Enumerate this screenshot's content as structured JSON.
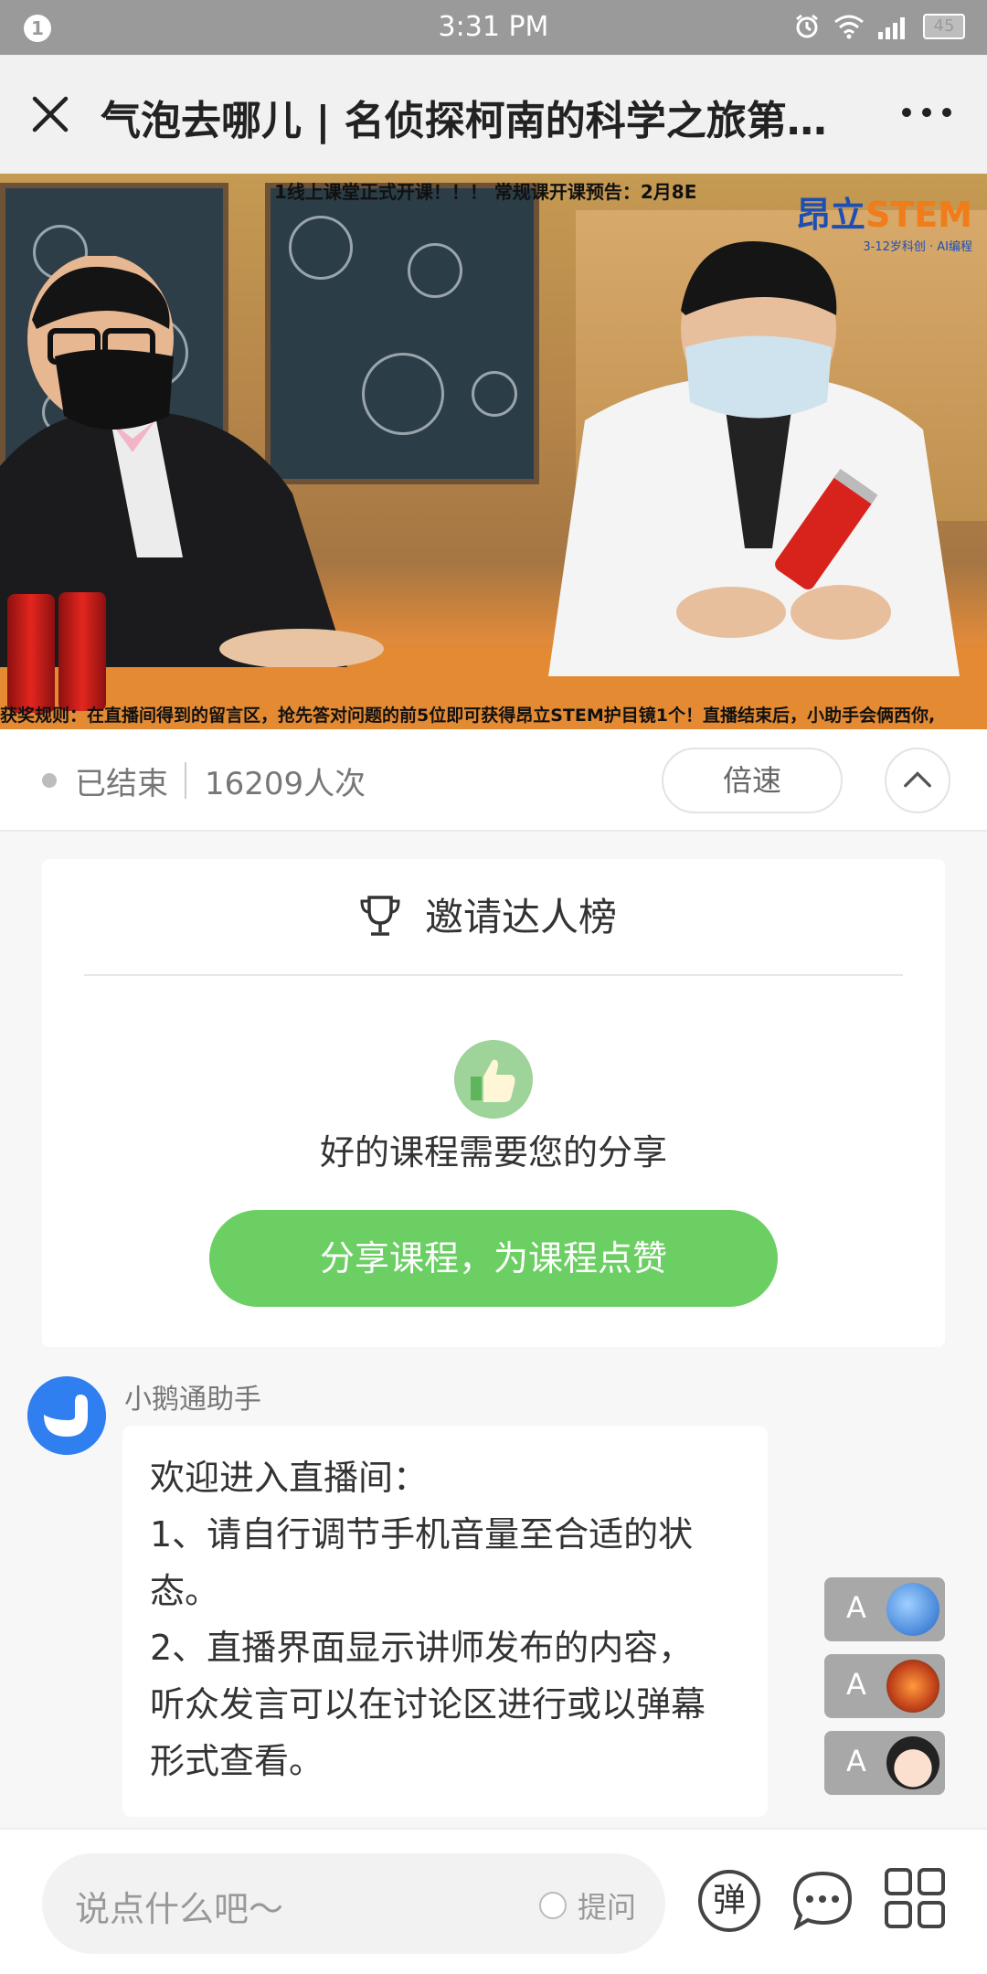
{
  "status_bar": {
    "time": "3:31 PM",
    "notification_badge": "1",
    "battery": "45"
  },
  "title_bar": {
    "title": "气泡去哪儿 | 名侦探柯南的科学之旅第…"
  },
  "video": {
    "top_caption": "1线上课堂正式开课！！！  常规课开课预告：2月8E",
    "logo_main": "昂立",
    "logo_stem": "STEM",
    "logo_sub": "3-12岁科创 · AI编程",
    "bottom_caption": "获奖规则：在直播间得到的留言区，抢先答对问题的前5位即可获得昂立STEM护目镜1个！直播结束后，小助手会俩西你,"
  },
  "info_row": {
    "status": "已结束",
    "views": "16209人次",
    "speed_label": "倍速"
  },
  "invite_card": {
    "title": "邀请达人榜",
    "message": "好的课程需要您的分享",
    "share_button": "分享课程，为课程点赞"
  },
  "chat": {
    "sender": "小鹅通助手",
    "message_lines": [
      "欢迎进入直播间：",
      "1、请自行调节手机音量至合适的状",
      "态。",
      "2、直播界面显示讲师发布的内容，",
      "听众发言可以在讨论区进行或以弹幕",
      "形式查看。"
    ]
  },
  "danmaku_toggles": [
    {
      "label": "A",
      "avatar": "blue-sky"
    },
    {
      "label": "A",
      "avatar": "orange-flower"
    },
    {
      "label": "A",
      "avatar": "baby"
    }
  ],
  "bottom_bar": {
    "input_placeholder": "说点什么吧～",
    "ask_label": "提问",
    "danmaku_button": "弹"
  },
  "colors": {
    "accent_green": "#6bcf63",
    "status_bar": "#9a9a9a",
    "assistant_blue": "#2f7ff0"
  }
}
